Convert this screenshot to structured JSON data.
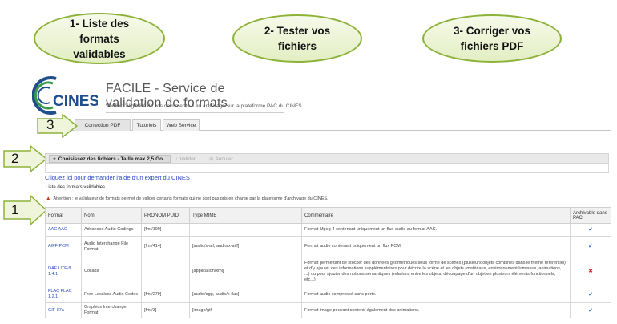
{
  "callouts": [
    {
      "label": "1- Liste des\nformats\nvalidables"
    },
    {
      "label": "2- Tester vos\nfichiers"
    },
    {
      "label": "3- Corriger vos\nfichiers PDF"
    }
  ],
  "step_markers": [
    "3",
    "2",
    "1"
  ],
  "header": {
    "logo_text": "CINES",
    "title": "FACILE - Service de validation de formats",
    "subtitle": "Vérifier l'éligibilité de vos documents à un archivage sur la plateforme PAC du CINES."
  },
  "tabs": [
    "Correction PDF",
    "Tutoriels",
    "Web Service"
  ],
  "toolbar": {
    "add_label": "Choisissez des fichiers - Taille max 2,5 Go",
    "validate_label": "Valider",
    "cancel_label": "Annuler"
  },
  "help_link": "Cliquez ici pour demander l'aide d'un expert du CINES",
  "section_title": "Liste des formats validables",
  "warning": "Attention : le validateur de formats permet de valider certains formats qui ne sont pas pris en charge par la plateforme d'archivage du CINES.",
  "table": {
    "headers": [
      "Format",
      "Nom",
      "PRONOM PUID",
      "Type MIME",
      "Commentaire",
      "Archivable dans PAC"
    ],
    "rows": [
      {
        "format": "AAC AAC",
        "nom": "Advanced Audio Codings",
        "puid": "[fmt/199]",
        "mime": "",
        "comment": "Format Mpeg-4 contenant uniquement un flux audio au format AAC.",
        "archivable": true
      },
      {
        "format": "AIFF PCM",
        "nom": "Audio Interchange File Format",
        "puid": "[fmt/414]",
        "mime": "[audio/x-aif, audio/x-aiff]",
        "comment": "Format audio contenant uniquement un flux PCM.",
        "archivable": true
      },
      {
        "format": "DAE UTF-8 1.4.1",
        "nom": "Collada",
        "puid": "",
        "mime": "[application/xml]",
        "comment": "Format permettant de stocker des données géométriques sous forme de scènes (plusieurs objets combinés dans le même référentiel) et d'y ajouter des informations supplémentaires pour décrire la scène et les objets (matériaux, environnement lumineux, animations, ...) ou pour ajouter des notions sémantiques (relations entre les objets, découpage d'un objet en plusieurs éléments fonctionnels, etc...)",
        "archivable": false
      },
      {
        "format": "FLAC FLAC 1.2.1",
        "nom": "Free Lossless Audio Codec",
        "puid": "[fmt/279]",
        "mime": "[audio/ogg, audio/x-flac]",
        "comment": "Format audio compressé sans perte.",
        "archivable": true
      },
      {
        "format": "GIF 87a",
        "nom": "Graphics Interchange Format",
        "puid": "[fmt/3]",
        "mime": "[image/gif]",
        "comment": "Format image pouvant contenir également des animations.",
        "archivable": true
      }
    ]
  },
  "colors": {
    "callout_border": "#8db23a",
    "callout_fill": "#e3eec3",
    "link": "#2a4bbf",
    "logo_blue": "#1f4e8c",
    "logo_green": "#3b9a4a"
  }
}
